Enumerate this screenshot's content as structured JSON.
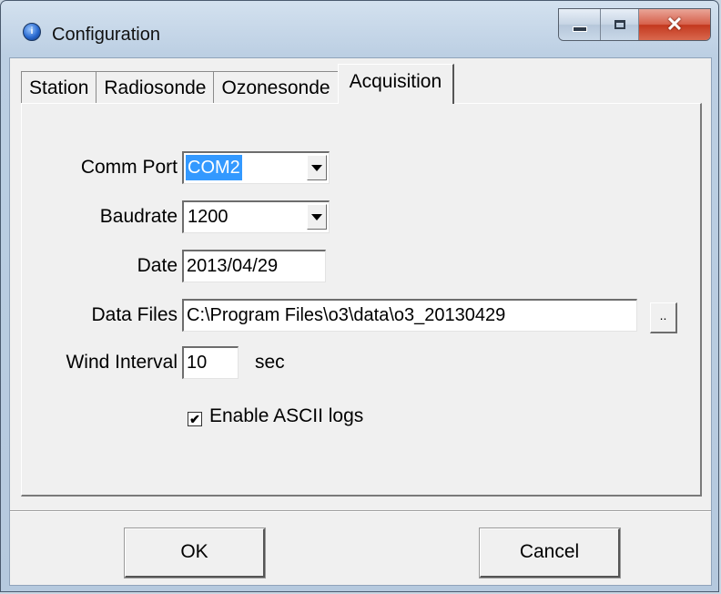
{
  "window": {
    "title": "Configuration",
    "icon": "app-info-icon",
    "app_icon_glyph": "i"
  },
  "caption_buttons": {
    "minimize_icon": "minimize-icon",
    "maximize_icon": "maximize-icon",
    "close_icon": "close-icon",
    "close_glyph": "✕"
  },
  "tabs": [
    {
      "label": "Station"
    },
    {
      "label": "Radiosonde"
    },
    {
      "label": "Ozonesonde"
    },
    {
      "label": "Acquisition"
    }
  ],
  "active_tab": "Acquisition",
  "form": {
    "comm_port": {
      "label": "Comm Port",
      "value": "COM2"
    },
    "baudrate": {
      "label": "Baudrate",
      "value": "1200"
    },
    "date": {
      "label": "Date",
      "value": "2013/04/29"
    },
    "data_files": {
      "label": "Data Files",
      "value": "C:\\Program Files\\o3\\data\\o3_20130429",
      "browse_label": ".."
    },
    "wind_interval": {
      "label": "Wind Interval",
      "value": "10",
      "unit": "sec"
    },
    "ascii_logs": {
      "label": "Enable ASCII logs",
      "checked": true,
      "check_glyph": "✔"
    }
  },
  "buttons": {
    "ok_label": "OK",
    "cancel_label": "Cancel"
  },
  "colors": {
    "selection": "#3399ff",
    "close_button": "#c3381e"
  }
}
